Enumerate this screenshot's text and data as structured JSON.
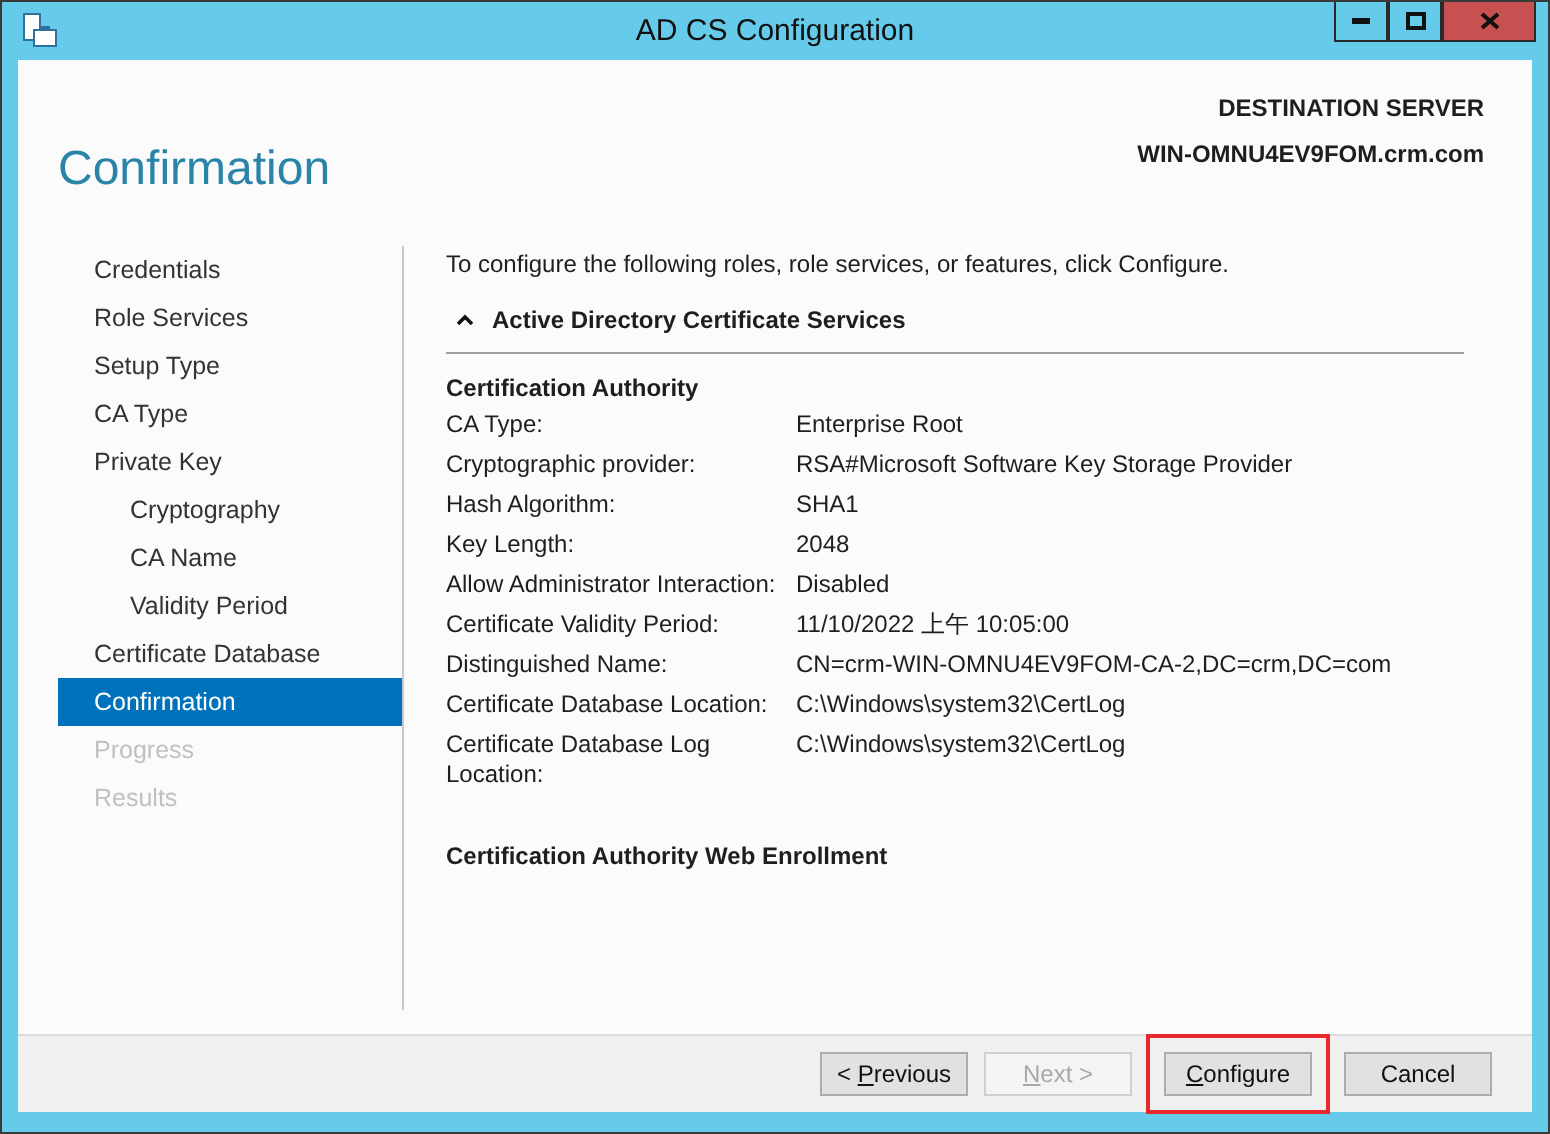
{
  "window": {
    "title": "AD CS Configuration"
  },
  "header": {
    "title": "Confirmation",
    "server_label": "DESTINATION SERVER",
    "server_name": "WIN-OMNU4EV9FOM.crm.com"
  },
  "sidebar": {
    "items": [
      {
        "label": "Credentials",
        "selected": false,
        "disabled": false
      },
      {
        "label": "Role Services",
        "selected": false,
        "disabled": false
      },
      {
        "label": "Setup Type",
        "selected": false,
        "disabled": false
      },
      {
        "label": "CA Type",
        "selected": false,
        "disabled": false
      },
      {
        "label": "Private Key",
        "selected": false,
        "disabled": false,
        "children": [
          {
            "label": "Cryptography",
            "selected": false,
            "disabled": false
          },
          {
            "label": "CA Name",
            "selected": false,
            "disabled": false
          },
          {
            "label": "Validity Period",
            "selected": false,
            "disabled": false
          }
        ]
      },
      {
        "label": "Certificate Database",
        "selected": false,
        "disabled": false
      },
      {
        "label": "Confirmation",
        "selected": true,
        "disabled": false
      },
      {
        "label": "Progress",
        "selected": false,
        "disabled": true
      },
      {
        "label": "Results",
        "selected": false,
        "disabled": true
      }
    ]
  },
  "content": {
    "intro": "To configure the following roles, role services, or features, click Configure.",
    "section": {
      "title": "Active Directory Certificate Services",
      "expanded": true,
      "groups": [
        {
          "title": "Certification Authority",
          "rows": [
            {
              "label": "CA Type:",
              "value": "Enterprise Root"
            },
            {
              "label": "Cryptographic provider:",
              "value": "RSA#Microsoft Software Key Storage Provider"
            },
            {
              "label": "Hash Algorithm:",
              "value": "SHA1"
            },
            {
              "label": "Key Length:",
              "value": "2048"
            },
            {
              "label": "Allow Administrator Interaction:",
              "value": "Disabled"
            },
            {
              "label": "Certificate Validity Period:",
              "value": "11/10/2022 上午 10:05:00"
            },
            {
              "label": "Distinguished Name:",
              "value": "CN=crm-WIN-OMNU4EV9FOM-CA-2,DC=crm,DC=com"
            },
            {
              "label": "Certificate Database Location:",
              "value": "C:\\Windows\\system32\\CertLog"
            },
            {
              "label": "Certificate Database Log Location:",
              "value": "C:\\Windows\\system32\\CertLog"
            }
          ]
        },
        {
          "title": "Certification Authority Web Enrollment"
        }
      ]
    }
  },
  "buttons": [
    {
      "label_before": "< ",
      "access_key": "P",
      "label_after": "revious",
      "disabled": false,
      "highlighted": false
    },
    {
      "access_key": "N",
      "label_after": "ext >",
      "disabled": true,
      "highlighted": false
    },
    {
      "access_key": "C",
      "label_after": "onfigure",
      "disabled": false,
      "highlighted": true
    },
    {
      "label_after": "Cancel",
      "disabled": false,
      "highlighted": false
    }
  ]
}
